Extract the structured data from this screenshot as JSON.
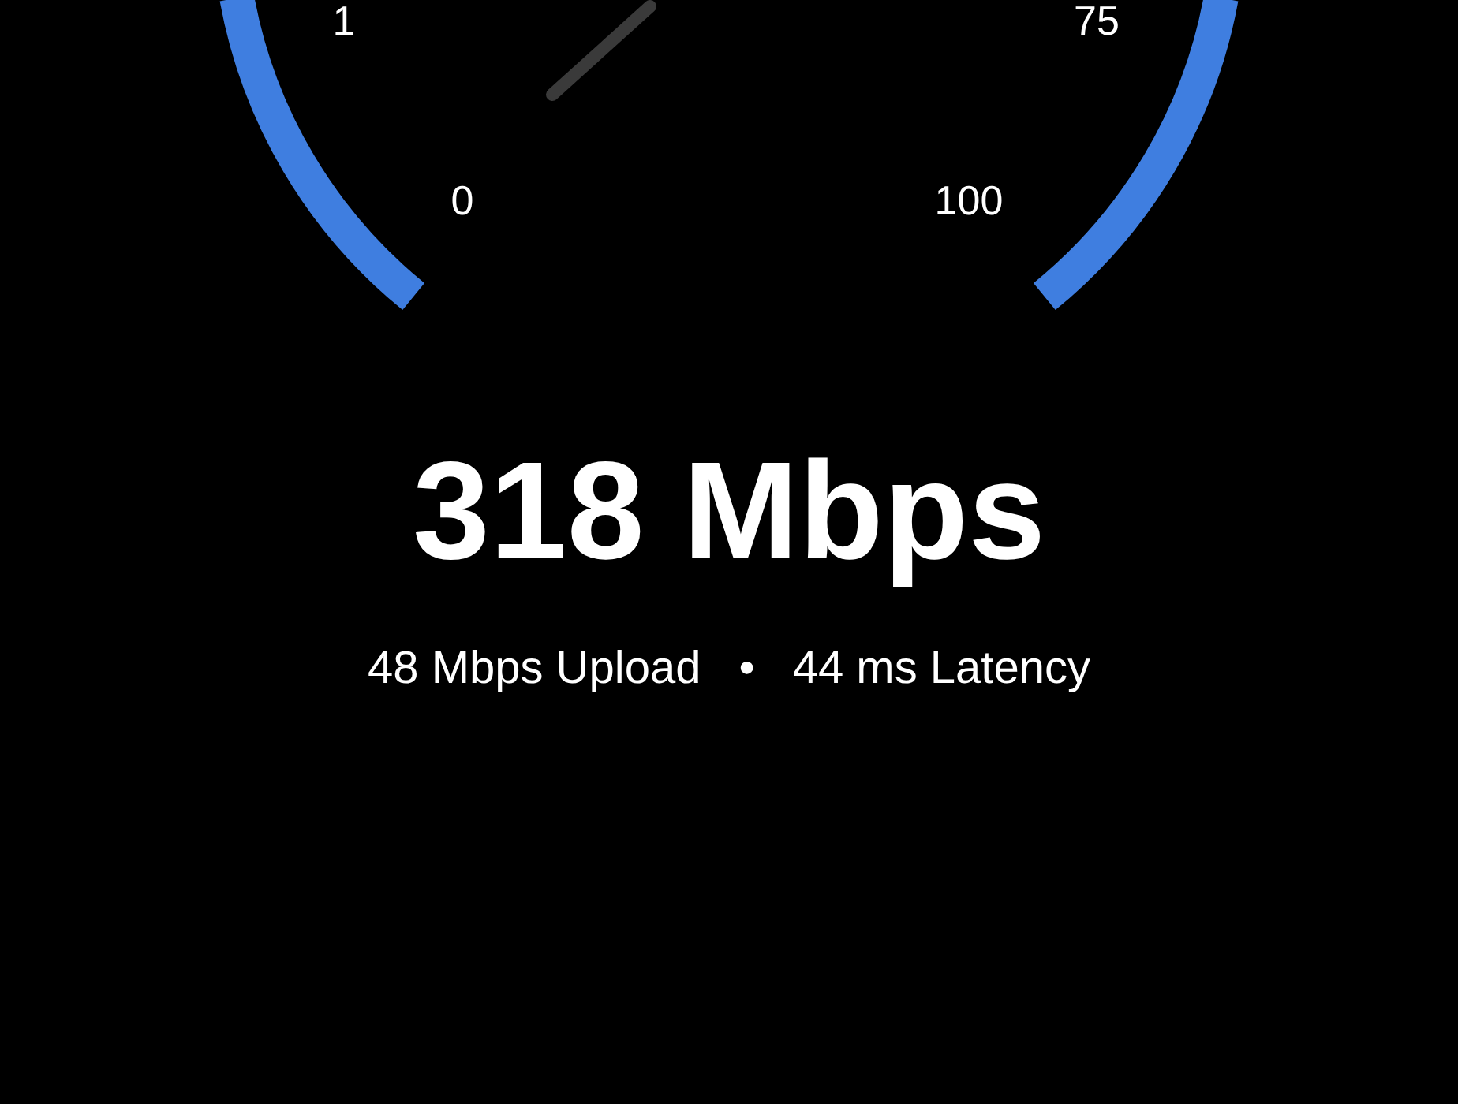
{
  "gauge": {
    "labels": [
      "1",
      "0",
      "100",
      "75"
    ]
  },
  "result": {
    "speed": "318 Mbps",
    "details": [
      "48 Mbps Upload",
      "44 ms Latency"
    ],
    "separator": "•"
  }
}
